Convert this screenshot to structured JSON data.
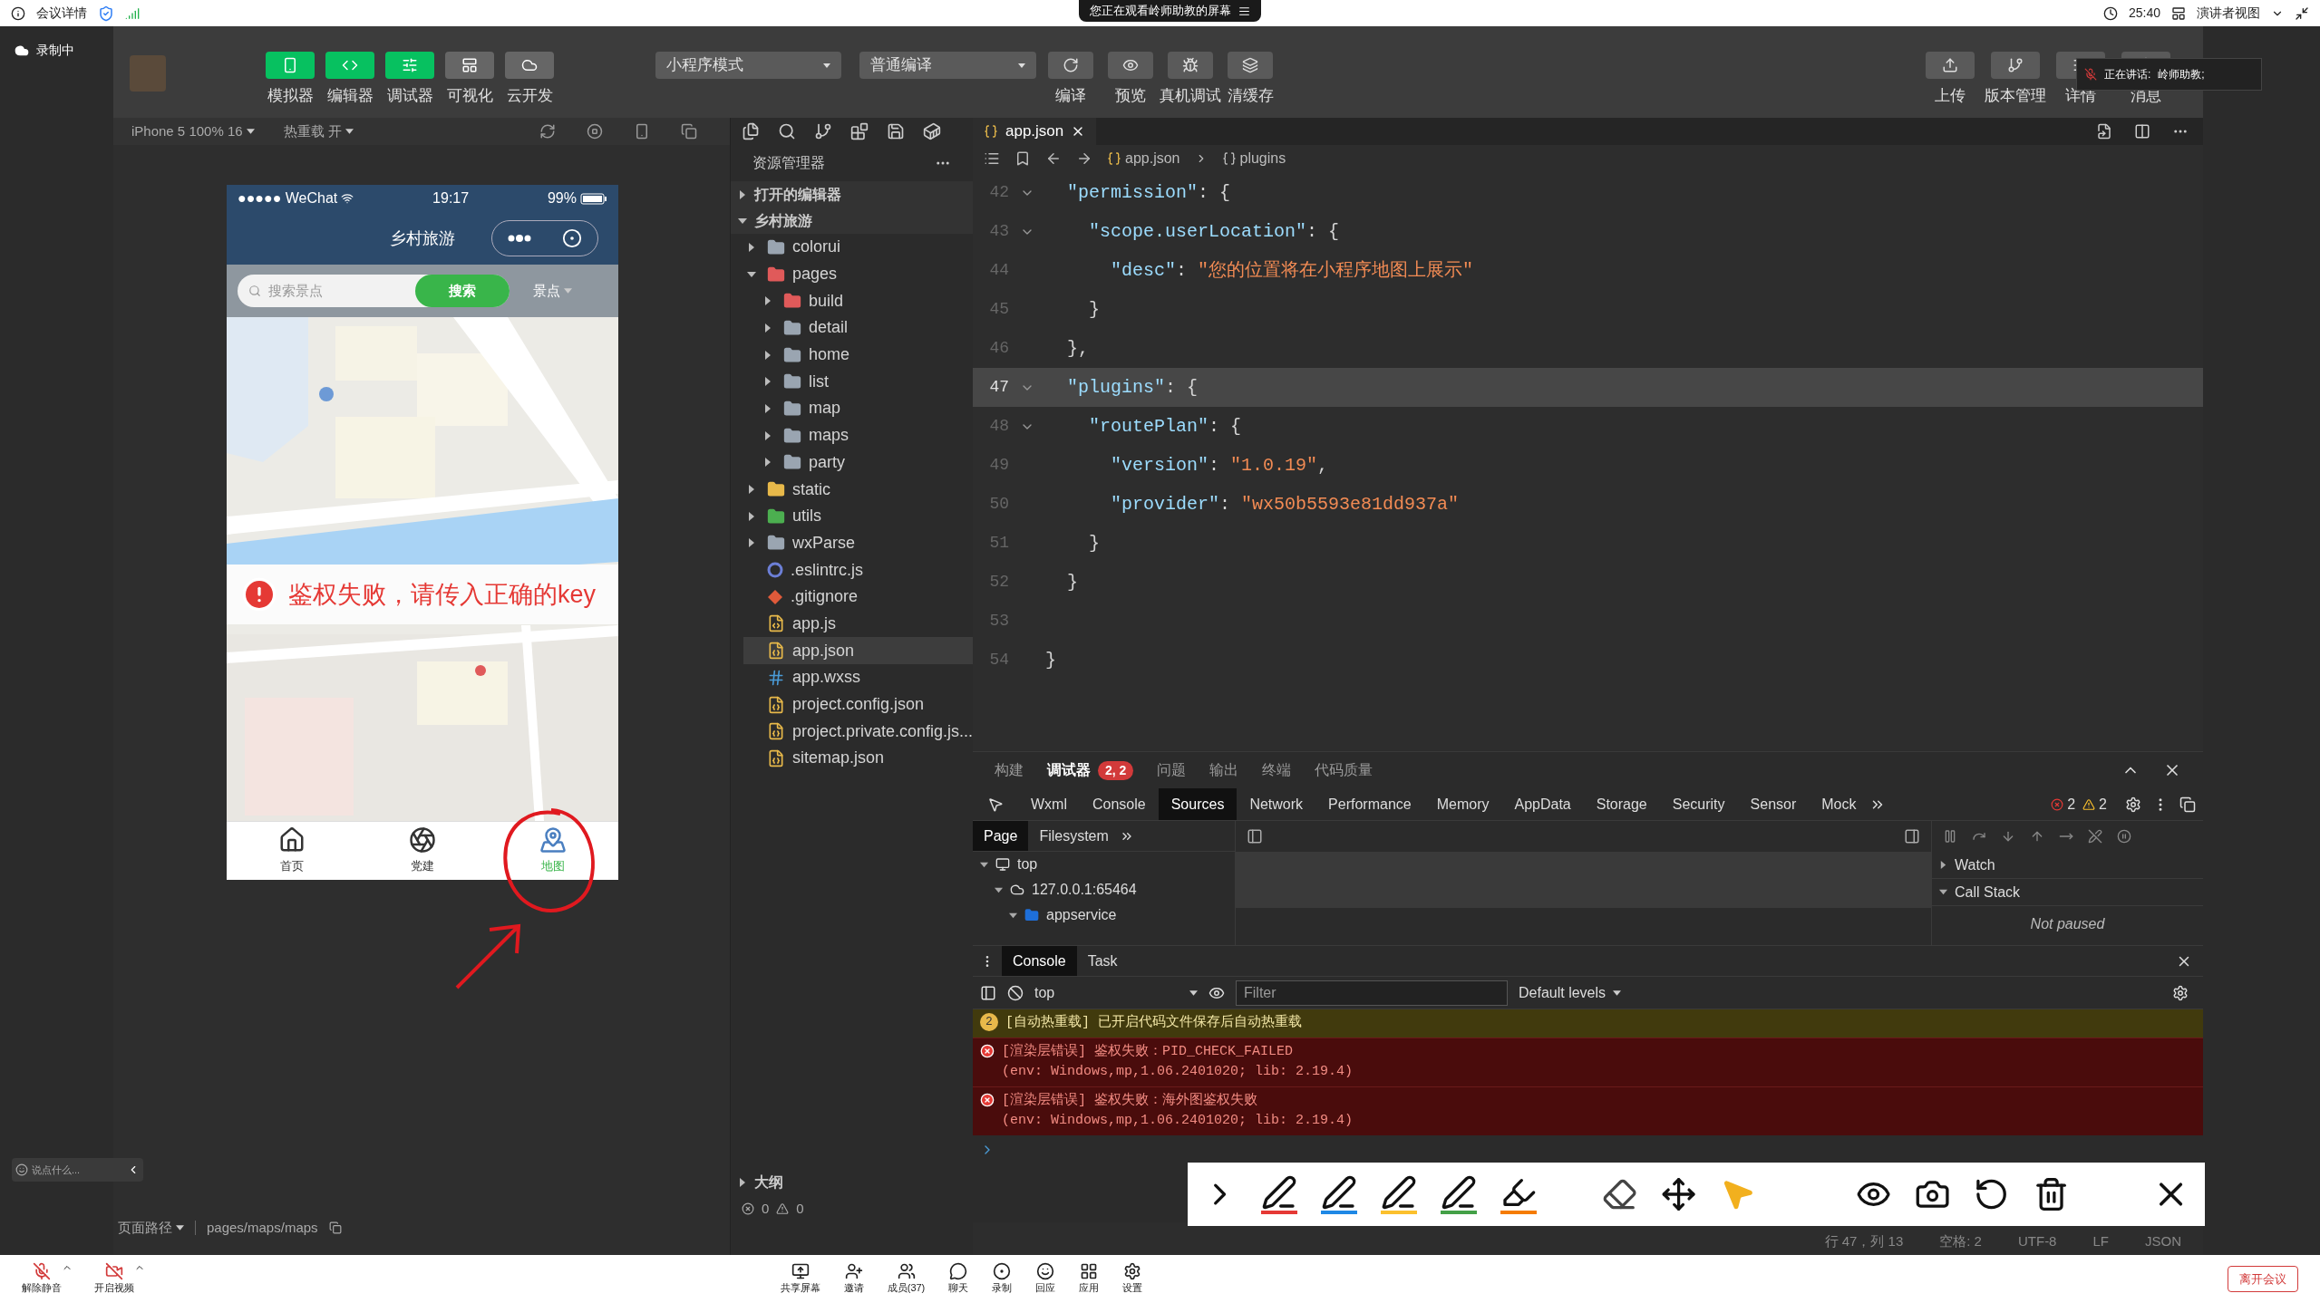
{
  "meeting": {
    "title": "会议详情",
    "share_notice": "您正在观看岭师助教的屏幕",
    "time": "25:40",
    "view": "演讲者视图",
    "recording": "录制中",
    "speaking_label": "正在讲话:",
    "speaker": "岭师助教;",
    "chat_placeholder": "说点什么...",
    "left_controls": [
      {
        "label": "解除静音"
      },
      {
        "label": "开启视频"
      }
    ],
    "center_controls": [
      {
        "label": "共享屏幕"
      },
      {
        "label": "邀请"
      },
      {
        "label": "成员(37)"
      },
      {
        "label": "聊天"
      },
      {
        "label": "录制"
      },
      {
        "label": "回应"
      },
      {
        "label": "应用"
      },
      {
        "label": "设置"
      }
    ],
    "leave": "离开会议"
  },
  "toolbar": {
    "left_buttons": [
      {
        "label": "模拟器",
        "on": true
      },
      {
        "label": "编辑器",
        "on": true
      },
      {
        "label": "调试器",
        "on": true
      },
      {
        "label": "可视化",
        "on": false
      },
      {
        "label": "云开发",
        "on": false
      }
    ],
    "mode": "小程序模式",
    "compile": "普通编译",
    "mid_buttons": [
      {
        "label": "编译"
      },
      {
        "label": "预览"
      },
      {
        "label": "真机调试"
      },
      {
        "label": "清缓存"
      }
    ],
    "right_buttons": [
      {
        "label": "上传"
      },
      {
        "label": "版本管理"
      },
      {
        "label": "详情"
      },
      {
        "label": "消息"
      }
    ]
  },
  "simulator": {
    "device": "iPhone 5 100% 16",
    "hot_reload": "热重载 开",
    "phone": {
      "carrier": "●●●●● WeChat",
      "time": "19:17",
      "battery": "99%",
      "title": "乡村旅游",
      "search_placeholder": "搜索景点",
      "search_button": "搜索",
      "filter": "景点",
      "error": "鉴权失败，请传入正确的key",
      "tabs": [
        {
          "label": "首页",
          "selected": false
        },
        {
          "label": "党建",
          "selected": false
        },
        {
          "label": "地图",
          "selected": true
        }
      ]
    }
  },
  "explorer": {
    "title": "资源管理器",
    "sections": [
      {
        "label": "打开的编辑器",
        "expanded": false
      },
      {
        "label": "乡村旅游",
        "expanded": true,
        "children": [
          {
            "label": "colorui",
            "kind": "folder",
            "expanded": false,
            "selected": false
          },
          {
            "label": "pages",
            "kind": "folder",
            "color": "#e05a5a",
            "expanded": true,
            "selected": false,
            "children": [
              {
                "label": "build",
                "kind": "folder",
                "color": "#e05a5a",
                "expanded": false,
                "selected": false
              },
              {
                "label": "detail",
                "kind": "folder",
                "expanded": false,
                "selected": false
              },
              {
                "label": "home",
                "kind": "folder",
                "expanded": false,
                "selected": false
              },
              {
                "label": "list",
                "kind": "folder",
                "expanded": false,
                "selected": false
              },
              {
                "label": "map",
                "kind": "folder",
                "expanded": false,
                "selected": false
              },
              {
                "label": "maps",
                "kind": "folder",
                "expanded": false,
                "selected": false
              },
              {
                "label": "party",
                "kind": "folder",
                "expanded": false,
                "selected": false
              }
            ]
          },
          {
            "label": "static",
            "kind": "folder",
            "color": "#e8b94a",
            "expanded": false,
            "selected": false
          },
          {
            "label": "utils",
            "kind": "folder",
            "color": "#4caf50",
            "expanded": false,
            "selected": false
          },
          {
            "label": "wxParse",
            "kind": "folder",
            "expanded": false,
            "selected": false
          },
          {
            "label": ".eslintrc.js",
            "kind": "eslint",
            "selected": false
          },
          {
            "label": ".gitignore",
            "kind": "git",
            "selected": false
          },
          {
            "label": "app.js",
            "kind": "js",
            "selected": false
          },
          {
            "label": "app.json",
            "kind": "json",
            "selected": true
          },
          {
            "label": "app.wxss",
            "kind": "wxss",
            "selected": false
          },
          {
            "label": "project.config.json",
            "kind": "json",
            "selected": false
          },
          {
            "label": "project.private.config.js...",
            "kind": "json",
            "selected": false
          },
          {
            "label": "sitemap.json",
            "kind": "json",
            "selected": false
          }
        ]
      }
    ],
    "outline": {
      "label": "大纲",
      "expanded": false
    },
    "errors": "0",
    "warnings": "0"
  },
  "page_path": {
    "label": "页面路径",
    "path": "pages/maps/maps"
  },
  "editor": {
    "tab": "app.json",
    "breadcrumb": [
      "app.json",
      "plugins"
    ],
    "lines": [
      {
        "number": "42",
        "fold": true,
        "current": false,
        "tokens": [
          {
            "kind": "key",
            "text": "  \"permission\""
          },
          {
            "kind": "punct",
            "text": ": {"
          }
        ]
      },
      {
        "number": "43",
        "fold": true,
        "current": false,
        "tokens": [
          {
            "kind": "key",
            "text": "    \"scope.userLocation\""
          },
          {
            "kind": "punct",
            "text": ": {"
          }
        ]
      },
      {
        "number": "44",
        "fold": false,
        "current": false,
        "tokens": [
          {
            "kind": "key",
            "text": "      \"desc\""
          },
          {
            "kind": "punct",
            "text": ": "
          },
          {
            "kind": "string",
            "text": "\"您的位置将在小程序地图上展示\""
          }
        ]
      },
      {
        "number": "45",
        "fold": false,
        "current": false,
        "tokens": [
          {
            "kind": "punct",
            "text": "    }"
          }
        ]
      },
      {
        "number": "46",
        "fold": false,
        "current": false,
        "tokens": [
          {
            "kind": "punct",
            "text": "  },"
          }
        ]
      },
      {
        "number": "47",
        "fold": true,
        "current": true,
        "tokens": [
          {
            "kind": "key",
            "text": "  \"plugins\""
          },
          {
            "kind": "punct",
            "text": ": {"
          }
        ]
      },
      {
        "number": "48",
        "fold": true,
        "current": false,
        "tokens": [
          {
            "kind": "key",
            "text": "    \"routePlan\""
          },
          {
            "kind": "punct",
            "text": ": {"
          }
        ]
      },
      {
        "number": "49",
        "fold": false,
        "current": false,
        "tokens": [
          {
            "kind": "key",
            "text": "      \"version\""
          },
          {
            "kind": "punct",
            "text": ": "
          },
          {
            "kind": "string",
            "text": "\"1.0.19\""
          },
          {
            "kind": "punct",
            "text": ","
          }
        ]
      },
      {
        "number": "50",
        "fold": false,
        "current": false,
        "tokens": [
          {
            "kind": "key",
            "text": "      \"provider\""
          },
          {
            "kind": "punct",
            "text": ": "
          },
          {
            "kind": "string",
            "text": "\"wx50b5593e81dd937a\""
          }
        ]
      },
      {
        "number": "51",
        "fold": false,
        "current": false,
        "tokens": [
          {
            "kind": "punct",
            "text": "    }"
          }
        ]
      },
      {
        "number": "52",
        "fold": false,
        "current": false,
        "tokens": [
          {
            "kind": "punct",
            "text": "  }"
          }
        ]
      },
      {
        "number": "53",
        "fold": false,
        "current": false
      },
      {
        "number": "54",
        "fold": false,
        "current": false,
        "tokens": [
          {
            "kind": "punct",
            "text": "}"
          }
        ]
      }
    ],
    "status": [
      "行 47，列 13",
      "空格: 2",
      "UTF-8",
      "LF",
      "JSON"
    ]
  },
  "panel": {
    "tabs": [
      {
        "label": "构建",
        "selected": false
      },
      {
        "label": "调试器",
        "selected": true,
        "badge": "2, 2"
      },
      {
        "label": "问题",
        "selected": false
      },
      {
        "label": "输出",
        "selected": false
      },
      {
        "label": "终端",
        "selected": false
      },
      {
        "label": "代码质量",
        "selected": false
      }
    ],
    "devtools_tabs": [
      {
        "label": "Wxml",
        "selected": false
      },
      {
        "label": "Console",
        "selected": false
      },
      {
        "label": "Sources",
        "selected": true
      },
      {
        "label": "Network",
        "selected": false
      },
      {
        "label": "Performance",
        "selected": false
      },
      {
        "label": "Memory",
        "selected": false
      },
      {
        "label": "AppData",
        "selected": false
      },
      {
        "label": "Storage",
        "selected": false
      },
      {
        "label": "Security",
        "selected": false
      },
      {
        "label": "Sensor",
        "selected": false
      },
      {
        "label": "Mock",
        "selected": false
      }
    ],
    "error_count": "2",
    "warning_count": "2",
    "sources_tabs": [
      {
        "label": "Page",
        "selected": true
      },
      {
        "label": "Filesystem",
        "selected": false
      }
    ],
    "sources_tree": [
      {
        "label": "top",
        "kind": "frame",
        "expanded": true,
        "children": [
          {
            "label": "127.0.0.1:65464",
            "kind": "cloud",
            "expanded": true,
            "children": [
              {
                "label": "appservice",
                "kind": "folder",
                "expanded": true
              }
            ]
          }
        ]
      }
    ],
    "watch": {
      "label": "Watch",
      "expanded": false
    },
    "call_stack": {
      "label": "Call Stack",
      "expanded": true,
      "note": "Not paused"
    },
    "drawer_tabs": [
      {
        "label": "Console",
        "selected": true
      },
      {
        "label": "Task",
        "selected": false
      }
    ],
    "context": "top",
    "filter_placeholder": "Filter",
    "levels": "Default levels",
    "messages": [
      {
        "kind": "warning",
        "count": "2",
        "lines": [
          "[自动热重载] 已开启代码文件保存后自动热重载"
        ]
      },
      {
        "kind": "error",
        "lines": [
          "[渲染层错误] 鉴权失败：PID_CHECK_FAILED",
          "(env: Windows,mp,1.06.2401020; lib: 2.19.4)"
        ]
      },
      {
        "kind": "error",
        "lines": [
          "[渲染层错误] 鉴权失败：海外图鉴权失败",
          "(env: Windows,mp,1.06.2401020; lib: 2.19.4)"
        ]
      }
    ]
  },
  "annotation_toolbar": {
    "pens": [
      {
        "kind": "pen",
        "color": "#e53935"
      },
      {
        "kind": "pen",
        "color": "#1e88e5"
      },
      {
        "kind": "pen",
        "color": "#fbc02d"
      },
      {
        "kind": "pen",
        "color": "#43a047"
      },
      {
        "kind": "highlighter",
        "color": "#f57c00"
      }
    ]
  }
}
